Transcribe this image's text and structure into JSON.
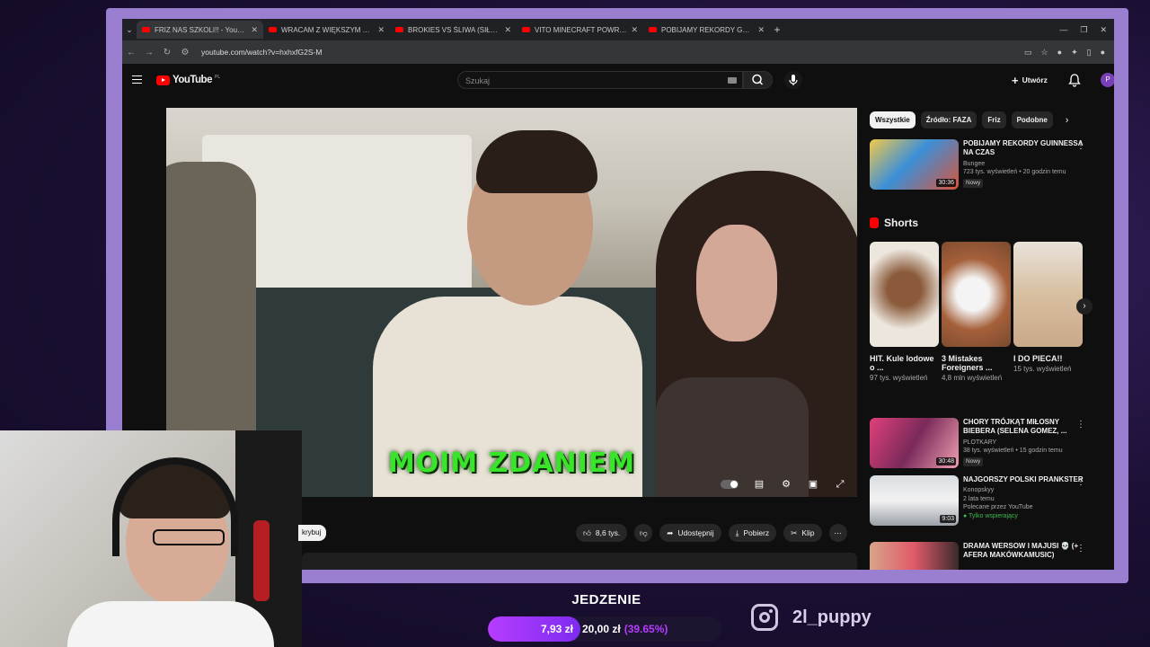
{
  "browser": {
    "tabs": [
      {
        "title": "FRIZ NAS SZKOLI!! - YouTube",
        "active": true
      },
      {
        "title": "WRACAM Z WIĘKSZYM PRZYT..."
      },
      {
        "title": "BROKIES VS ŚLIWA (SIŁOWNIA..."
      },
      {
        "title": "VITO MINECRAFT POWRÓCIŁ X..."
      },
      {
        "title": "POBIJAMY REKORDY GUINNES..."
      }
    ],
    "url": "youtube.com/watch?v=hxhxfG2S-M"
  },
  "youtube": {
    "logo": "YouTube",
    "logo_region": "PL",
    "search_placeholder": "Szukaj",
    "create_label": "Utwórz",
    "avatar_letter": "P"
  },
  "video": {
    "subtitle": "MOIM ZDANIEM",
    "likes": "8,6 tys.",
    "share_label": "Udostępnij",
    "download_label": "Pobierz",
    "clip_label": "Klip",
    "hide_label": "krybuj"
  },
  "sidebar": {
    "chips": [
      "Wszystkie",
      "Źródło: FAZA",
      "Friz",
      "Podobne"
    ],
    "top_video": {
      "title": "POBIJAMY REKORDY GUINNESSA NA CZAS",
      "channel": "Bungee",
      "meta": "723 tys. wyświetleń • 20 godzin temu",
      "badge": "Nowy",
      "duration": "30:36"
    },
    "shorts_heading": "Shorts",
    "shorts": [
      {
        "title": "HIT. Kule lodowe o ...",
        "views": "97 tys. wyświetleń",
        "color": "#e8e0d6"
      },
      {
        "title": "3 Mistakes Foreigners ...",
        "views": "4,8 mln wyświetleń",
        "color": "#c8a088"
      },
      {
        "title": "I DO PIECA!!",
        "views": "15 tys. wyświetleń",
        "color": "#d9c8b4"
      }
    ],
    "videos": [
      {
        "title": "CHORY TRÓJKĄT MIŁOSNY BIEBERA (SELENA GOMEZ, ...",
        "channel": "PLOTKARY",
        "meta": "38 tys. wyświetleń • 15 godzin temu",
        "badge": "Nowy",
        "duration": "30:48"
      },
      {
        "title": "NAJGORSZY POLSKI PRANKSTER",
        "channel": "Konopskyy",
        "meta": "2 lata temu",
        "extra": "Polecane przez YouTube",
        "members": "Tylko wspierający",
        "duration": "9:03"
      },
      {
        "title": "DRAMA WERSOW I MAJUSI 💀 (+ AFERA MAKÓWKAMUSIC)",
        "channel": "",
        "meta": ""
      }
    ]
  },
  "stream": {
    "goal_title": "JEDZENIE",
    "goal_current": "7,93 zł",
    "goal_max": "20,00 zł",
    "goal_percent": "(39.65%)",
    "goal_fraction": 0.3965,
    "instagram": "2l_puppy"
  }
}
